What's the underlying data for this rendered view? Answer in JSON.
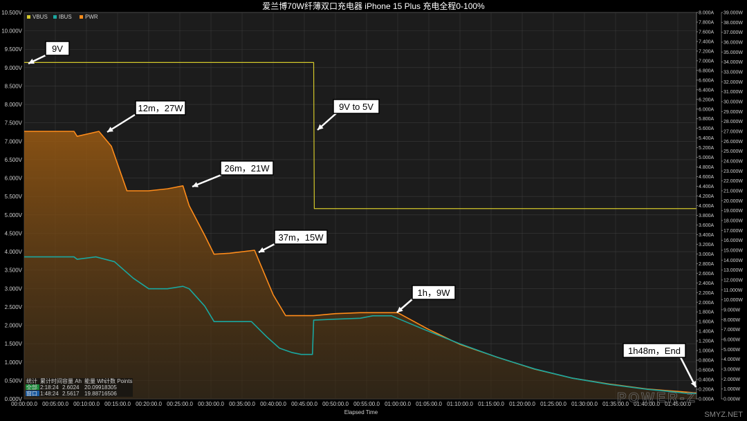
{
  "chart_data": {
    "type": "line",
    "title": "爱兰博70W纤薄双口充电器 iPhone 15 Plus 充电全程0-100%",
    "xlabel": "Elapsed Time",
    "x_ticks": [
      "00:00:00.0",
      "00:05:00.0",
      "00:10:00.0",
      "00:15:00.0",
      "00:20:00.0",
      "00:25:00.0",
      "00:30:00.0",
      "00:35:00.0",
      "00:40:00.0",
      "00:45:00.0",
      "00:50:00.0",
      "00:55:00.0",
      "01:00:00.0",
      "01:05:00.0",
      "01:10:00.0",
      "01:15:00.0",
      "01:20:00.0",
      "01:25:00.0",
      "01:30:00.0",
      "01:35:00.0",
      "01:40:00.0",
      "01:45:00.0"
    ],
    "x_range_min": [
      0,
      108
    ],
    "y_left_range": [
      0,
      10.5
    ],
    "y_left_ticks": [
      "0.000V",
      "0.500V",
      "1.000V",
      "1.500V",
      "2.000V",
      "2.500V",
      "3.000V",
      "3.500V",
      "4.000V",
      "4.500V",
      "5.000V",
      "5.500V",
      "6.000V",
      "6.500V",
      "7.000V",
      "7.500V",
      "8.000V",
      "8.500V",
      "9.000V",
      "9.500V",
      "10.000V",
      "10.500V"
    ],
    "y_right1_range": [
      0,
      8
    ],
    "y_right1_ticks": [
      "0.000A",
      "0.200A",
      "0.400A",
      "0.600A",
      "0.800A",
      "1.000A",
      "1.200A",
      "1.400A",
      "1.600A",
      "1.800A",
      "2.000A",
      "2.200A",
      "2.400A",
      "2.600A",
      "2.800A",
      "3.000A",
      "3.200A",
      "3.400A",
      "3.600A",
      "3.800A",
      "4.000A",
      "4.200A",
      "4.400A",
      "4.600A",
      "4.800A",
      "5.000A",
      "5.200A",
      "5.400A",
      "5.600A",
      "5.800A",
      "6.000A",
      "6.200A",
      "6.400A",
      "6.600A",
      "6.800A",
      "7.000A",
      "7.200A",
      "7.400A",
      "7.600A",
      "7.800A",
      "8.000A"
    ],
    "y_right2_range": [
      0,
      39
    ],
    "y_right2_ticks": [
      "0.000W",
      "1.000W",
      "2.000W",
      "3.000W",
      "4.000W",
      "5.000W",
      "6.000W",
      "7.000W",
      "8.000W",
      "9.000W",
      "10.000W",
      "11.000W",
      "12.000W",
      "13.000W",
      "14.000W",
      "15.000W",
      "16.000W",
      "17.000W",
      "18.000W",
      "19.000W",
      "20.000W",
      "21.000W",
      "22.000W",
      "23.000W",
      "24.000W",
      "25.000W",
      "26.000W",
      "27.000W",
      "28.000W",
      "29.000W",
      "30.000W",
      "31.000W",
      "32.000W",
      "33.000W",
      "34.000W",
      "35.000W",
      "36.000W",
      "37.000W",
      "38.000W",
      "39.000W"
    ],
    "grid": true,
    "legend_position": "top-left",
    "colors": {
      "VBUS": "#d4c82a",
      "IBUS": "#1aa7a0",
      "PWR": "#ff8c1a",
      "bg": "#1c1c1c",
      "grid": "#3a3a3a"
    },
    "series": [
      {
        "name": "VBUS",
        "axis": "left",
        "x": [
          0,
          46.5,
          46.6,
          108
        ],
        "values": [
          9.14,
          9.14,
          5.17,
          5.17
        ]
      },
      {
        "name": "IBUS",
        "axis": "right1",
        "x": [
          0,
          8,
          8.5,
          11.5,
          14.5,
          17.5,
          20,
          23,
          25.5,
          26.5,
          29,
          30.5,
          33,
          36.5,
          39,
          41,
          43,
          44.5,
          46.3,
          46.5,
          50,
          54,
          56,
          59,
          64,
          70,
          76,
          82,
          88,
          94,
          100,
          104,
          106,
          108
        ],
        "values": [
          2.94,
          2.94,
          2.89,
          2.94,
          2.84,
          2.5,
          2.28,
          2.28,
          2.33,
          2.28,
          1.92,
          1.6,
          1.6,
          1.6,
          1.28,
          1.05,
          0.96,
          0.92,
          0.92,
          1.63,
          1.65,
          1.67,
          1.72,
          1.72,
          1.45,
          1.14,
          0.86,
          0.62,
          0.43,
          0.3,
          0.2,
          0.15,
          0.12,
          0.11
        ]
      },
      {
        "name": "PWR",
        "axis": "right2",
        "x": [
          0,
          8,
          8.5,
          12,
          14,
          16.5,
          20,
          23,
          25.5,
          26.5,
          29,
          30.5,
          33,
          37,
          40,
          42,
          46.5,
          50,
          54,
          56,
          60,
          65,
          70,
          76,
          82,
          88,
          94,
          100,
          104,
          106,
          108
        ],
        "values": [
          27.0,
          27.0,
          26.5,
          27.0,
          25.5,
          21.0,
          21.0,
          21.2,
          21.5,
          19.5,
          16.5,
          14.6,
          14.7,
          15.0,
          10.5,
          8.4,
          8.4,
          8.6,
          8.7,
          8.7,
          8.7,
          7.0,
          5.5,
          4.2,
          3.0,
          2.1,
          1.5,
          1.0,
          0.8,
          0.7,
          0.6
        ]
      }
    ],
    "annotations": [
      {
        "label": "9V",
        "series": "VBUS",
        "x": 0.3,
        "value": 9.14
      },
      {
        "label": "12m，27W",
        "series": "PWR",
        "x": 12,
        "value": 27.0
      },
      {
        "label": "26m，21W",
        "series": "PWR",
        "x": 25.5,
        "value": 21.5
      },
      {
        "label": "9V to 5V",
        "series": "VBUS",
        "x": 46.6,
        "value": 7.4
      },
      {
        "label": "37m，15W",
        "series": "PWR",
        "x": 37,
        "value": 15.0
      },
      {
        "label": "1h，9W",
        "series": "PWR",
        "x": 60,
        "value": 8.7
      },
      {
        "label": "1h48m，End",
        "series": "PWR",
        "x": 108,
        "value": 0.6
      }
    ],
    "stats_table": {
      "headers": [
        "统计",
        "累计时间",
        "容量 Ah",
        "能量 Wh",
        "计数 Points"
      ],
      "rows": [
        [
          "全部",
          "2:18:24",
          "2.6024",
          "20.0991",
          "8305"
        ],
        [
          "窗口",
          "1:48:24",
          "2.5617",
          "19.8871",
          "6506"
        ]
      ]
    },
    "watermark": "POWER-Z",
    "corner_watermark": "SMYZ.NET"
  }
}
